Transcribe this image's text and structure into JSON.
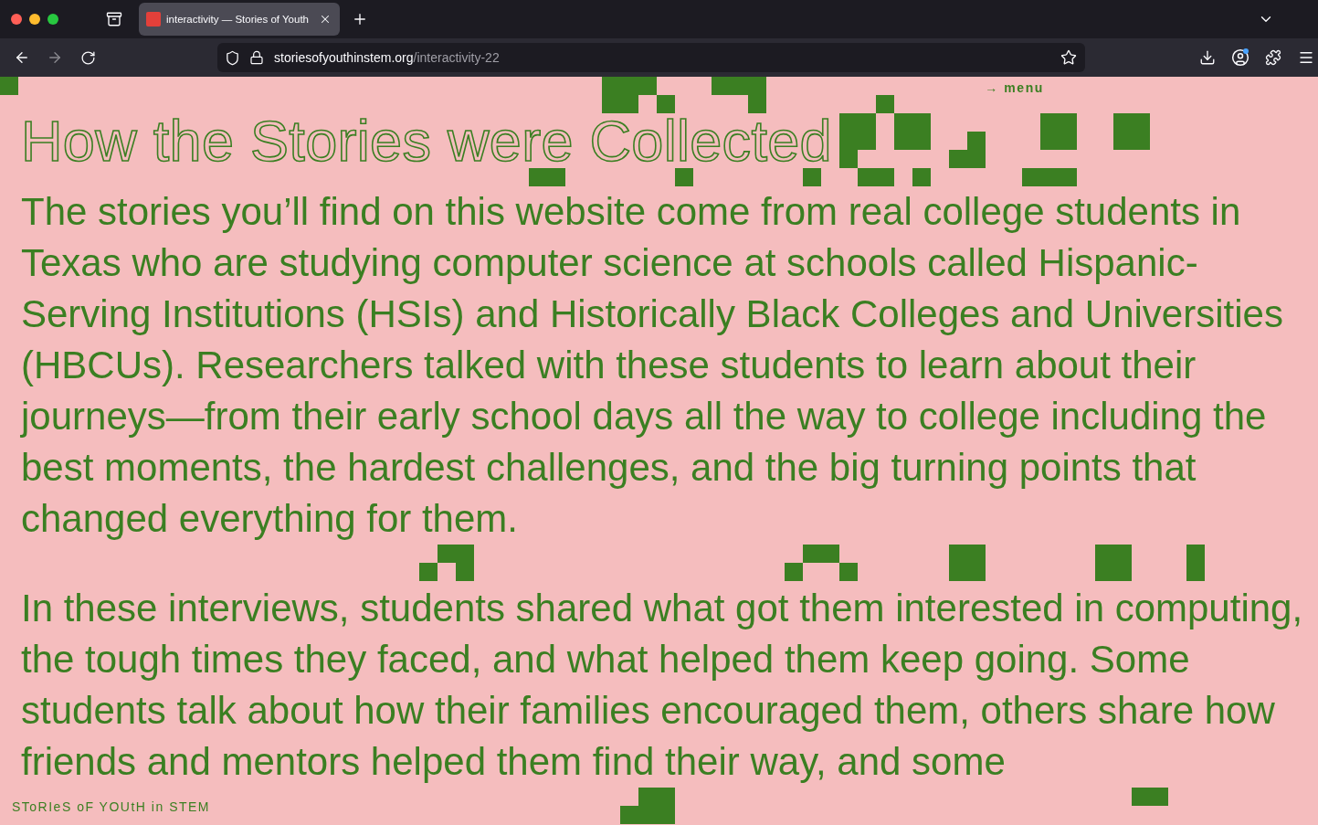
{
  "browser": {
    "tabs": [
      {
        "title": "interactivity — Stories of Youth",
        "selected": true
      }
    ],
    "address": {
      "domain": "storiesofyouthinstem.org",
      "path": "/interactivity-22"
    }
  },
  "page": {
    "menu_link": "→ menu",
    "title": "How the Stories were Collected",
    "paragraphs": [
      "The stories you’ll find on this website come from real college students in Texas who are studying computer science at schools called Hispanic-Serving Institutions (HSIs) and Historically Black Colleges and Universities (HBCUs). Researchers talked with these students to learn about their journeys—from their early school days all the way to college including the best moments, the hardest challenges, and the big turning points that changed everything for them.",
      "In these interviews, students shared what got them interested in computing, the tough times they faced, and what helped them keep going. Some students talk about how their families encouraged them, others share how friends and mentors helped them find their way, and some"
    ],
    "footer": "SToRIeS oF YOUtH in STEM"
  }
}
